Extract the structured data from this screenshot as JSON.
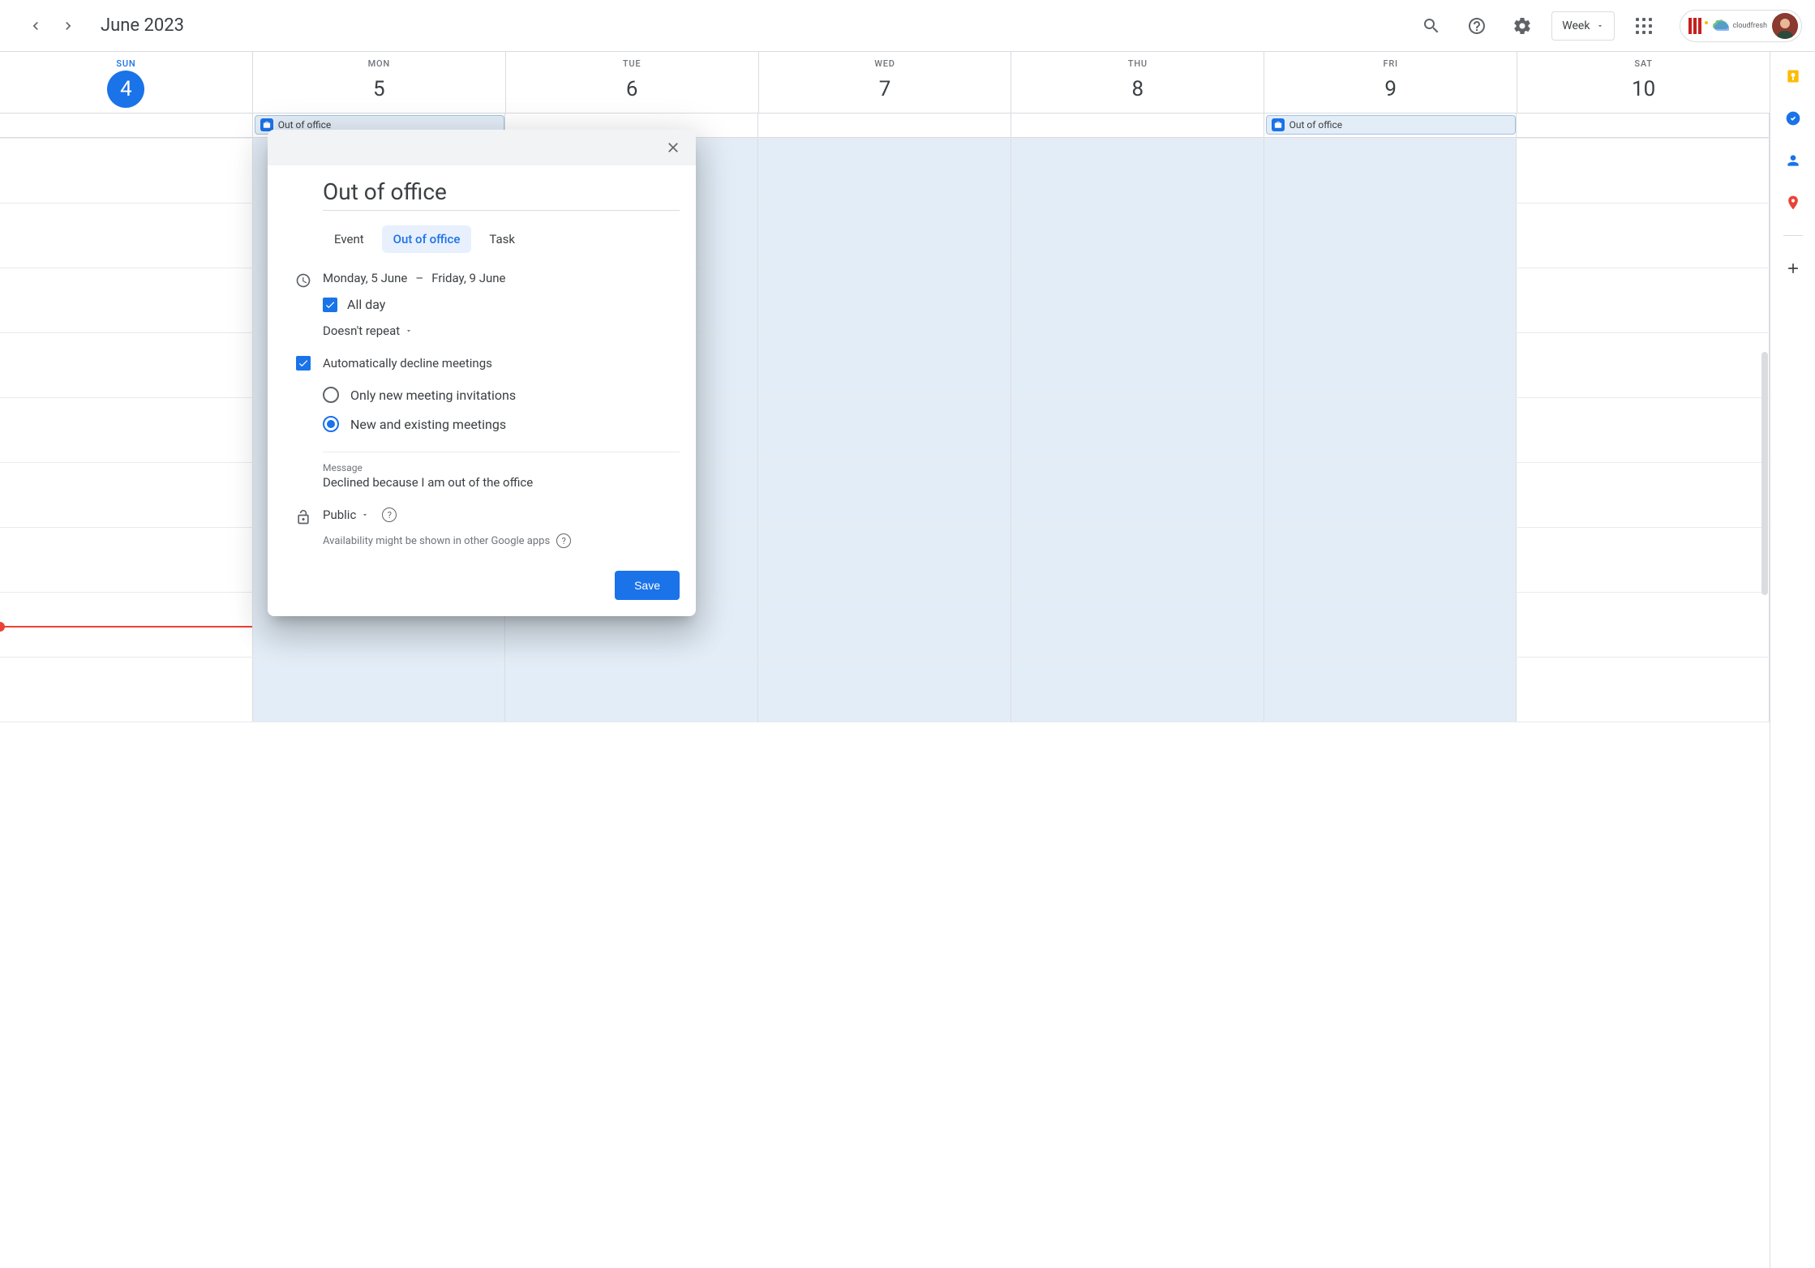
{
  "header": {
    "title": "June 2023",
    "view_label": "Week"
  },
  "days": [
    {
      "label": "SUN",
      "num": "4",
      "today": true
    },
    {
      "label": "MON",
      "num": "5",
      "ooo": true,
      "chip": "Out of office"
    },
    {
      "label": "TUE",
      "num": "6",
      "ooo": true
    },
    {
      "label": "WED",
      "num": "7",
      "ooo": true
    },
    {
      "label": "THU",
      "num": "8",
      "ooo": true
    },
    {
      "label": "FRI",
      "num": "9",
      "ooo": true,
      "chip": "Out of office"
    },
    {
      "label": "SAT",
      "num": "10"
    }
  ],
  "dialog": {
    "title": "Out of office",
    "tabs": {
      "event": "Event",
      "ooo": "Out of office",
      "task": "Task"
    },
    "date_start": "Monday, 5 June",
    "date_sep": "–",
    "date_end": "Friday, 9 June",
    "all_day": "All day",
    "repeat": "Doesn't repeat",
    "auto_decline": "Automatically decline meetings",
    "radio_new": "Only new meeting invitations",
    "radio_all": "New and existing meetings",
    "message_label": "Message",
    "message_value": "Declined because I am out of the office",
    "visibility": "Public",
    "availability_hint": "Availability might be shown in other Google apps",
    "save": "Save"
  },
  "rail": {
    "keep": "keep",
    "tasks": "tasks",
    "contacts": "contacts",
    "maps": "maps",
    "add": "add"
  },
  "brand": {
    "cloudfresh": "cloudfresh"
  }
}
